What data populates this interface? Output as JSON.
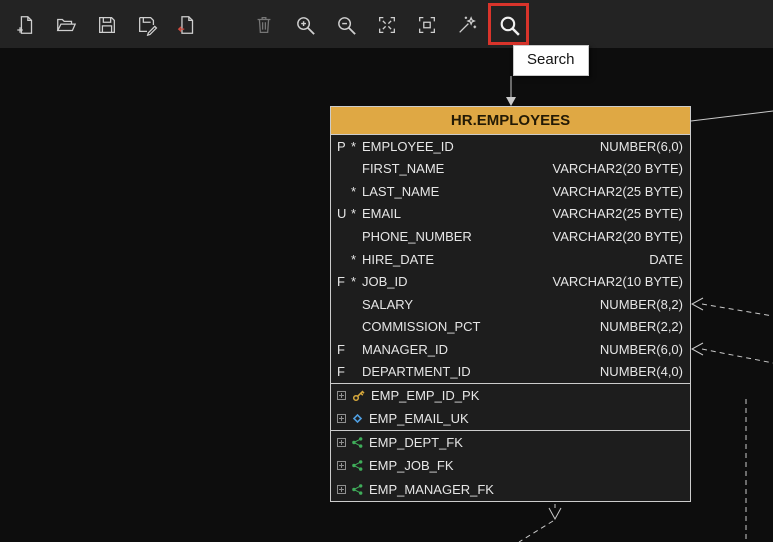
{
  "colors": {
    "canvas_bg": "#0d0d0d",
    "toolbar_bg": "#232323",
    "table_header_bg": "#dfa844",
    "table_header_text": "#231a05",
    "table_body_bg": "#1d1d1d",
    "table_border": "#cccccc",
    "text": "#e6e6e6",
    "highlight_red": "#d9342b",
    "pk_gold": "#d8a93c",
    "uk_blue": "#4f9ee0",
    "fk_green": "#3fae5a"
  },
  "toolbar": {
    "tooltip": "Search"
  },
  "table": {
    "title": "HR.EMPLOYEES",
    "columns": [
      {
        "key": "P",
        "mandatory": true,
        "name": "EMPLOYEE_ID",
        "type": "NUMBER(6,0)"
      },
      {
        "key": "",
        "mandatory": false,
        "name": "FIRST_NAME",
        "type": "VARCHAR2(20 BYTE)"
      },
      {
        "key": "",
        "mandatory": true,
        "name": "LAST_NAME",
        "type": "VARCHAR2(25 BYTE)"
      },
      {
        "key": "U",
        "mandatory": true,
        "name": "EMAIL",
        "type": "VARCHAR2(25 BYTE)"
      },
      {
        "key": "",
        "mandatory": false,
        "name": "PHONE_NUMBER",
        "type": "VARCHAR2(20 BYTE)"
      },
      {
        "key": "",
        "mandatory": true,
        "name": "HIRE_DATE",
        "type": "DATE"
      },
      {
        "key": "F",
        "mandatory": true,
        "name": "JOB_ID",
        "type": "VARCHAR2(10 BYTE)"
      },
      {
        "key": "",
        "mandatory": false,
        "name": "SALARY",
        "type": "NUMBER(8,2)"
      },
      {
        "key": "",
        "mandatory": false,
        "name": "COMMISSION_PCT",
        "type": "NUMBER(2,2)"
      },
      {
        "key": "F",
        "mandatory": false,
        "name": "MANAGER_ID",
        "type": "NUMBER(6,0)"
      },
      {
        "key": "F",
        "mandatory": false,
        "name": "DEPARTMENT_ID",
        "type": "NUMBER(4,0)"
      }
    ],
    "keys": [
      {
        "icon": "primary-key",
        "name": "EMP_EMP_ID_PK"
      },
      {
        "icon": "unique-key",
        "name": "EMP_EMAIL_UK"
      }
    ],
    "foreign_keys": [
      {
        "icon": "foreign-key",
        "name": "EMP_DEPT_FK"
      },
      {
        "icon": "foreign-key",
        "name": "EMP_JOB_FK"
      },
      {
        "icon": "foreign-key",
        "name": "EMP_MANAGER_FK"
      }
    ]
  }
}
